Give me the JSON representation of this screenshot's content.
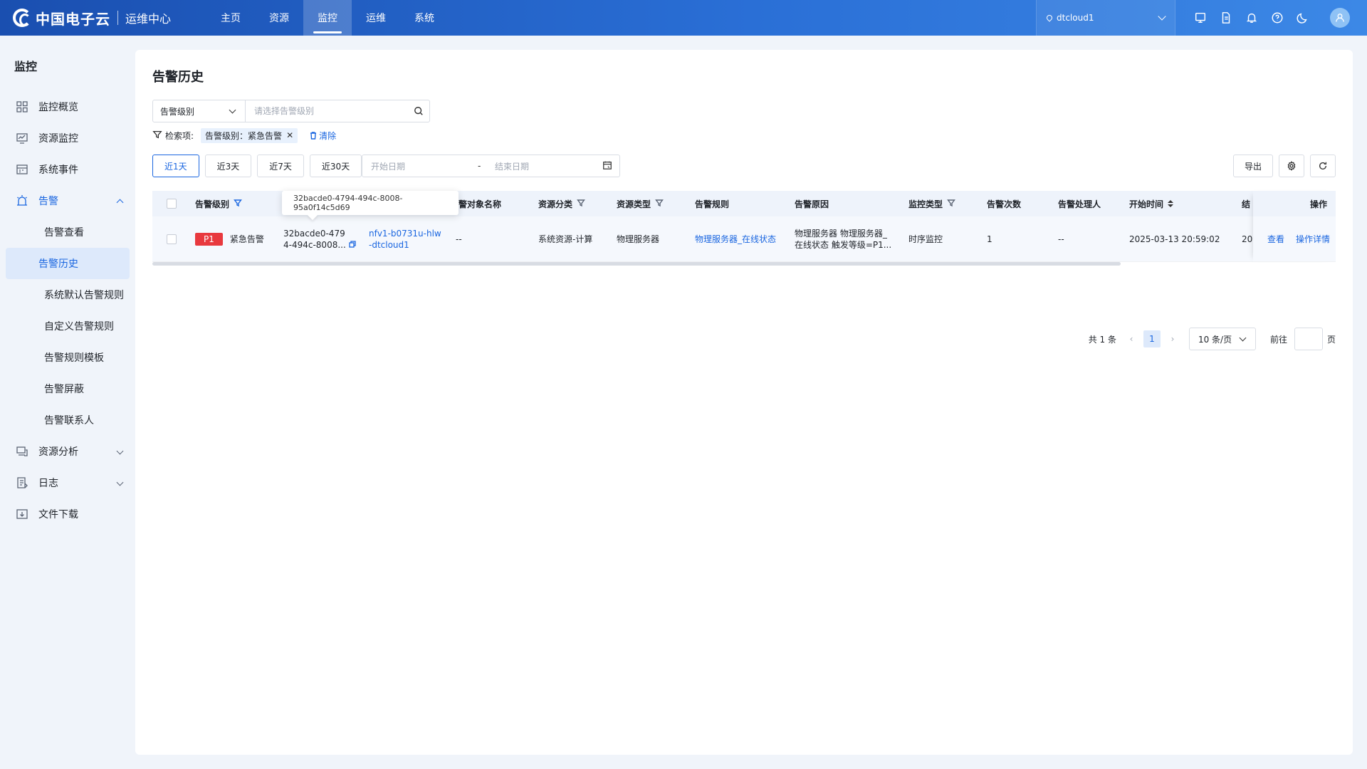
{
  "header": {
    "brand": "中国电子云",
    "subtitle": "运维中心",
    "nav": [
      "主页",
      "资源",
      "监控",
      "运维",
      "系统"
    ],
    "region": "dtcloud1"
  },
  "sidebar": {
    "title": "监控",
    "items": [
      {
        "label": "监控概览"
      },
      {
        "label": "资源监控"
      },
      {
        "label": "系统事件"
      },
      {
        "label": "告警"
      },
      {
        "label": "资源分析"
      },
      {
        "label": "日志"
      },
      {
        "label": "文件下载"
      }
    ],
    "alarm_subs": [
      "告警查看",
      "告警历史",
      "系统默认告警规则",
      "自定义告警规则",
      "告警规则模板",
      "告警屏蔽",
      "告警联系人"
    ]
  },
  "page": {
    "title": "告警历史",
    "filter_select": "告警级别",
    "filter_placeholder": "请选择告警级别",
    "criteria_label": "检索项:",
    "criteria_tag": "告警级别：紧急告警",
    "clear": "清除",
    "quick": [
      "近1天",
      "近3天",
      "近7天",
      "近30天"
    ],
    "start_date": "开始日期",
    "date_sep": "-",
    "end_date": "结束日期",
    "export": "导出"
  },
  "table": {
    "headers": {
      "level": "告警级别",
      "obj_name": "警对象名称",
      "res_class": "资源分类",
      "res_type": "资源类型",
      "rule": "告警规则",
      "reason": "告警原因",
      "mon_type": "监控类型",
      "count": "告警次数",
      "handler": "告警处理人",
      "start": "开始时间",
      "end_partial": "结",
      "ops": "操作"
    },
    "row": {
      "badge": "P1",
      "level": "紧急告警",
      "id_line1": "32bacde0-479",
      "id_line2": "4-494c-8008...",
      "res_line1": "nfv1-b0731u-hlw",
      "res_line2": "-dtcloud1",
      "obj_name": "--",
      "res_class": "系统资源-计算",
      "res_type": "物理服务器",
      "rule": "物理服务器_在线状态",
      "reason_line1": "物理服务器 物理服务器_",
      "reason_line2": "在线状态 触发等级=P1...",
      "mon_type": "时序监控",
      "count": "1",
      "handler": "--",
      "start": "2025-03-13 20:59:02",
      "end_partial": "20",
      "view": "查看",
      "detail": "操作详情"
    },
    "tooltip": "32bacde0-4794-494c-8008-95a0f14c5d69"
  },
  "pager": {
    "total": "共 1 条",
    "page": "1",
    "size": "10 条/页",
    "goto": "前往",
    "page_unit": "页"
  }
}
